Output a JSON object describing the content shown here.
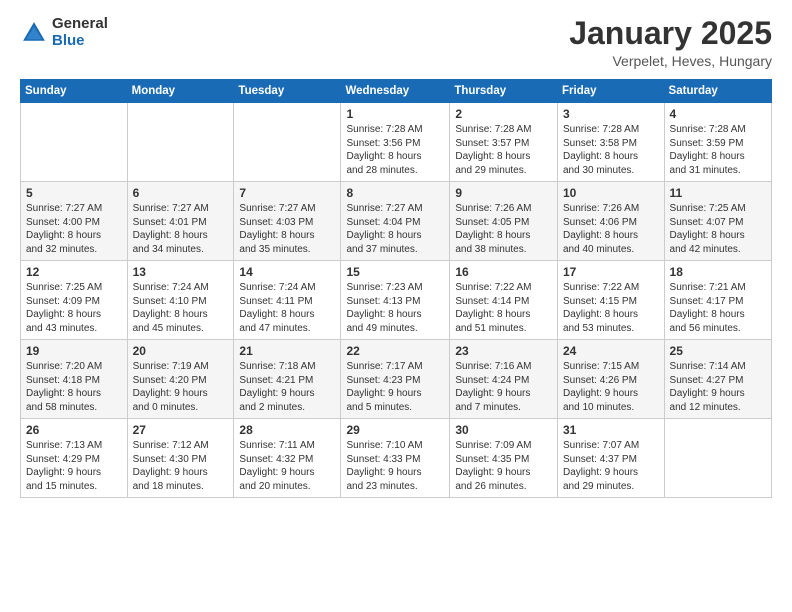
{
  "header": {
    "logo_general": "General",
    "logo_blue": "Blue",
    "title": "January 2025",
    "location": "Verpelet, Heves, Hungary"
  },
  "days_of_week": [
    "Sunday",
    "Monday",
    "Tuesday",
    "Wednesday",
    "Thursday",
    "Friday",
    "Saturday"
  ],
  "weeks": [
    [
      {
        "day": "",
        "info": ""
      },
      {
        "day": "",
        "info": ""
      },
      {
        "day": "",
        "info": ""
      },
      {
        "day": "1",
        "info": "Sunrise: 7:28 AM\nSunset: 3:56 PM\nDaylight: 8 hours\nand 28 minutes."
      },
      {
        "day": "2",
        "info": "Sunrise: 7:28 AM\nSunset: 3:57 PM\nDaylight: 8 hours\nand 29 minutes."
      },
      {
        "day": "3",
        "info": "Sunrise: 7:28 AM\nSunset: 3:58 PM\nDaylight: 8 hours\nand 30 minutes."
      },
      {
        "day": "4",
        "info": "Sunrise: 7:28 AM\nSunset: 3:59 PM\nDaylight: 8 hours\nand 31 minutes."
      }
    ],
    [
      {
        "day": "5",
        "info": "Sunrise: 7:27 AM\nSunset: 4:00 PM\nDaylight: 8 hours\nand 32 minutes."
      },
      {
        "day": "6",
        "info": "Sunrise: 7:27 AM\nSunset: 4:01 PM\nDaylight: 8 hours\nand 34 minutes."
      },
      {
        "day": "7",
        "info": "Sunrise: 7:27 AM\nSunset: 4:03 PM\nDaylight: 8 hours\nand 35 minutes."
      },
      {
        "day": "8",
        "info": "Sunrise: 7:27 AM\nSunset: 4:04 PM\nDaylight: 8 hours\nand 37 minutes."
      },
      {
        "day": "9",
        "info": "Sunrise: 7:26 AM\nSunset: 4:05 PM\nDaylight: 8 hours\nand 38 minutes."
      },
      {
        "day": "10",
        "info": "Sunrise: 7:26 AM\nSunset: 4:06 PM\nDaylight: 8 hours\nand 40 minutes."
      },
      {
        "day": "11",
        "info": "Sunrise: 7:25 AM\nSunset: 4:07 PM\nDaylight: 8 hours\nand 42 minutes."
      }
    ],
    [
      {
        "day": "12",
        "info": "Sunrise: 7:25 AM\nSunset: 4:09 PM\nDaylight: 8 hours\nand 43 minutes."
      },
      {
        "day": "13",
        "info": "Sunrise: 7:24 AM\nSunset: 4:10 PM\nDaylight: 8 hours\nand 45 minutes."
      },
      {
        "day": "14",
        "info": "Sunrise: 7:24 AM\nSunset: 4:11 PM\nDaylight: 8 hours\nand 47 minutes."
      },
      {
        "day": "15",
        "info": "Sunrise: 7:23 AM\nSunset: 4:13 PM\nDaylight: 8 hours\nand 49 minutes."
      },
      {
        "day": "16",
        "info": "Sunrise: 7:22 AM\nSunset: 4:14 PM\nDaylight: 8 hours\nand 51 minutes."
      },
      {
        "day": "17",
        "info": "Sunrise: 7:22 AM\nSunset: 4:15 PM\nDaylight: 8 hours\nand 53 minutes."
      },
      {
        "day": "18",
        "info": "Sunrise: 7:21 AM\nSunset: 4:17 PM\nDaylight: 8 hours\nand 56 minutes."
      }
    ],
    [
      {
        "day": "19",
        "info": "Sunrise: 7:20 AM\nSunset: 4:18 PM\nDaylight: 8 hours\nand 58 minutes."
      },
      {
        "day": "20",
        "info": "Sunrise: 7:19 AM\nSunset: 4:20 PM\nDaylight: 9 hours\nand 0 minutes."
      },
      {
        "day": "21",
        "info": "Sunrise: 7:18 AM\nSunset: 4:21 PM\nDaylight: 9 hours\nand 2 minutes."
      },
      {
        "day": "22",
        "info": "Sunrise: 7:17 AM\nSunset: 4:23 PM\nDaylight: 9 hours\nand 5 minutes."
      },
      {
        "day": "23",
        "info": "Sunrise: 7:16 AM\nSunset: 4:24 PM\nDaylight: 9 hours\nand 7 minutes."
      },
      {
        "day": "24",
        "info": "Sunrise: 7:15 AM\nSunset: 4:26 PM\nDaylight: 9 hours\nand 10 minutes."
      },
      {
        "day": "25",
        "info": "Sunrise: 7:14 AM\nSunset: 4:27 PM\nDaylight: 9 hours\nand 12 minutes."
      }
    ],
    [
      {
        "day": "26",
        "info": "Sunrise: 7:13 AM\nSunset: 4:29 PM\nDaylight: 9 hours\nand 15 minutes."
      },
      {
        "day": "27",
        "info": "Sunrise: 7:12 AM\nSunset: 4:30 PM\nDaylight: 9 hours\nand 18 minutes."
      },
      {
        "day": "28",
        "info": "Sunrise: 7:11 AM\nSunset: 4:32 PM\nDaylight: 9 hours\nand 20 minutes."
      },
      {
        "day": "29",
        "info": "Sunrise: 7:10 AM\nSunset: 4:33 PM\nDaylight: 9 hours\nand 23 minutes."
      },
      {
        "day": "30",
        "info": "Sunrise: 7:09 AM\nSunset: 4:35 PM\nDaylight: 9 hours\nand 26 minutes."
      },
      {
        "day": "31",
        "info": "Sunrise: 7:07 AM\nSunset: 4:37 PM\nDaylight: 9 hours\nand 29 minutes."
      },
      {
        "day": "",
        "info": ""
      }
    ]
  ]
}
